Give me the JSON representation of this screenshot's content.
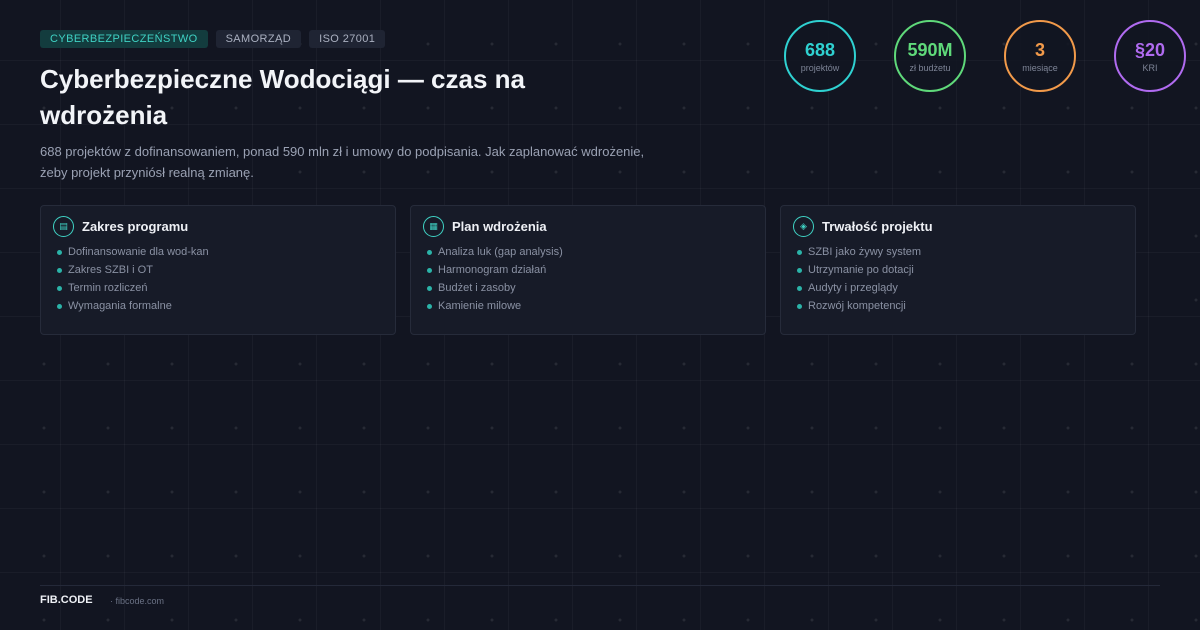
{
  "tags": [
    "CYBERBEZPIECZEŃSTWO",
    "SAMORZĄD",
    "ISO 27001"
  ],
  "title": "Cyberbezpieczne Wodociągi — czas na wdrożenia",
  "subtitle": "688 projektów z dofinansowaniem, ponad 590 mln zł i umowy do podpisania. Jak zaplanować wdrożenie, żeby projekt przyniósł realną zmianę.",
  "stats": [
    {
      "value": "688",
      "label": "projektów",
      "color": "#2fd1d1"
    },
    {
      "value": "590M",
      "label": "zł budżetu",
      "color": "#5fd97a"
    },
    {
      "value": "3",
      "label": "miesiące",
      "color": "#f29a4a"
    },
    {
      "value": "§20",
      "label": "KRI",
      "color": "#b06bf0"
    }
  ],
  "cards": [
    {
      "title": "Zakres programu",
      "icon": "document-icon",
      "items": [
        "Dofinansowanie dla wod-kan",
        "Zakres SZBI i OT",
        "Termin rozliczeń",
        "Wymagania formalne"
      ]
    },
    {
      "title": "Plan wdrożenia",
      "icon": "calendar-icon",
      "items": [
        "Analiza luk (gap analysis)",
        "Harmonogram działań",
        "Budżet i zasoby",
        "Kamienie milowe"
      ]
    },
    {
      "title": "Trwałość projektu",
      "icon": "shield-icon",
      "items": [
        "SZBI jako żywy system",
        "Utrzymanie po dotacji",
        "Audyty i przeglądy",
        "Rozwój kompetencji"
      ]
    }
  ],
  "footer": {
    "brand": "FIB.CODE",
    "domain": "· fibcode.com"
  }
}
